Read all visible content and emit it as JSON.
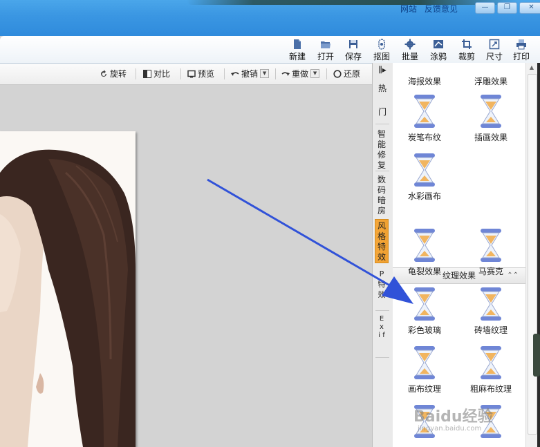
{
  "top_links": [
    "网站",
    "反馈意见"
  ],
  "window_buttons": [
    "—",
    "❐",
    "✕"
  ],
  "toolbar": [
    {
      "label": "新建",
      "icon": "new-file-icon"
    },
    {
      "label": "打开",
      "icon": "open-folder-icon"
    },
    {
      "label": "保存",
      "icon": "save-icon"
    },
    {
      "label": "抠图",
      "icon": "cutout-icon"
    },
    {
      "label": "批量",
      "icon": "batch-gear-icon"
    },
    {
      "label": "涂鸦",
      "icon": "doodle-icon"
    },
    {
      "label": "裁剪",
      "icon": "crop-icon"
    },
    {
      "label": "尺寸",
      "icon": "resize-icon"
    },
    {
      "label": "打印",
      "icon": "print-icon"
    }
  ],
  "subbar": {
    "rotate": "旋转",
    "compare": "对比",
    "preview": "预览",
    "undo": "撤销",
    "redo": "重做",
    "restore": "还原"
  },
  "vtabs": {
    "hot_1": "热",
    "hot_2": "门",
    "smart_fix": "智能修复",
    "darkroom": "数码暗房",
    "style_fx": "风格特效",
    "p_fx": "P 特效",
    "exif": "E x i f"
  },
  "panel": {
    "top_items": [
      "海报效果",
      "浮雕效果"
    ],
    "row2": [
      "炭笔布纹",
      "插画效果"
    ],
    "row3": [
      "水彩画布"
    ],
    "section_title": "纹理效果",
    "texture_items": [
      [
        "龟裂效果",
        "马赛克"
      ],
      [
        "彩色玻璃",
        "砖墙纹理"
      ],
      [
        "画布纹理",
        "粗麻布纹理"
      ]
    ]
  },
  "colors": {
    "titlebar": "#3a96e2",
    "active_tab": "#f0a030",
    "arrow": "#3152d8"
  },
  "watermark": {
    "main": "Baidu经验",
    "sub": "jingyan.baidu.com"
  }
}
